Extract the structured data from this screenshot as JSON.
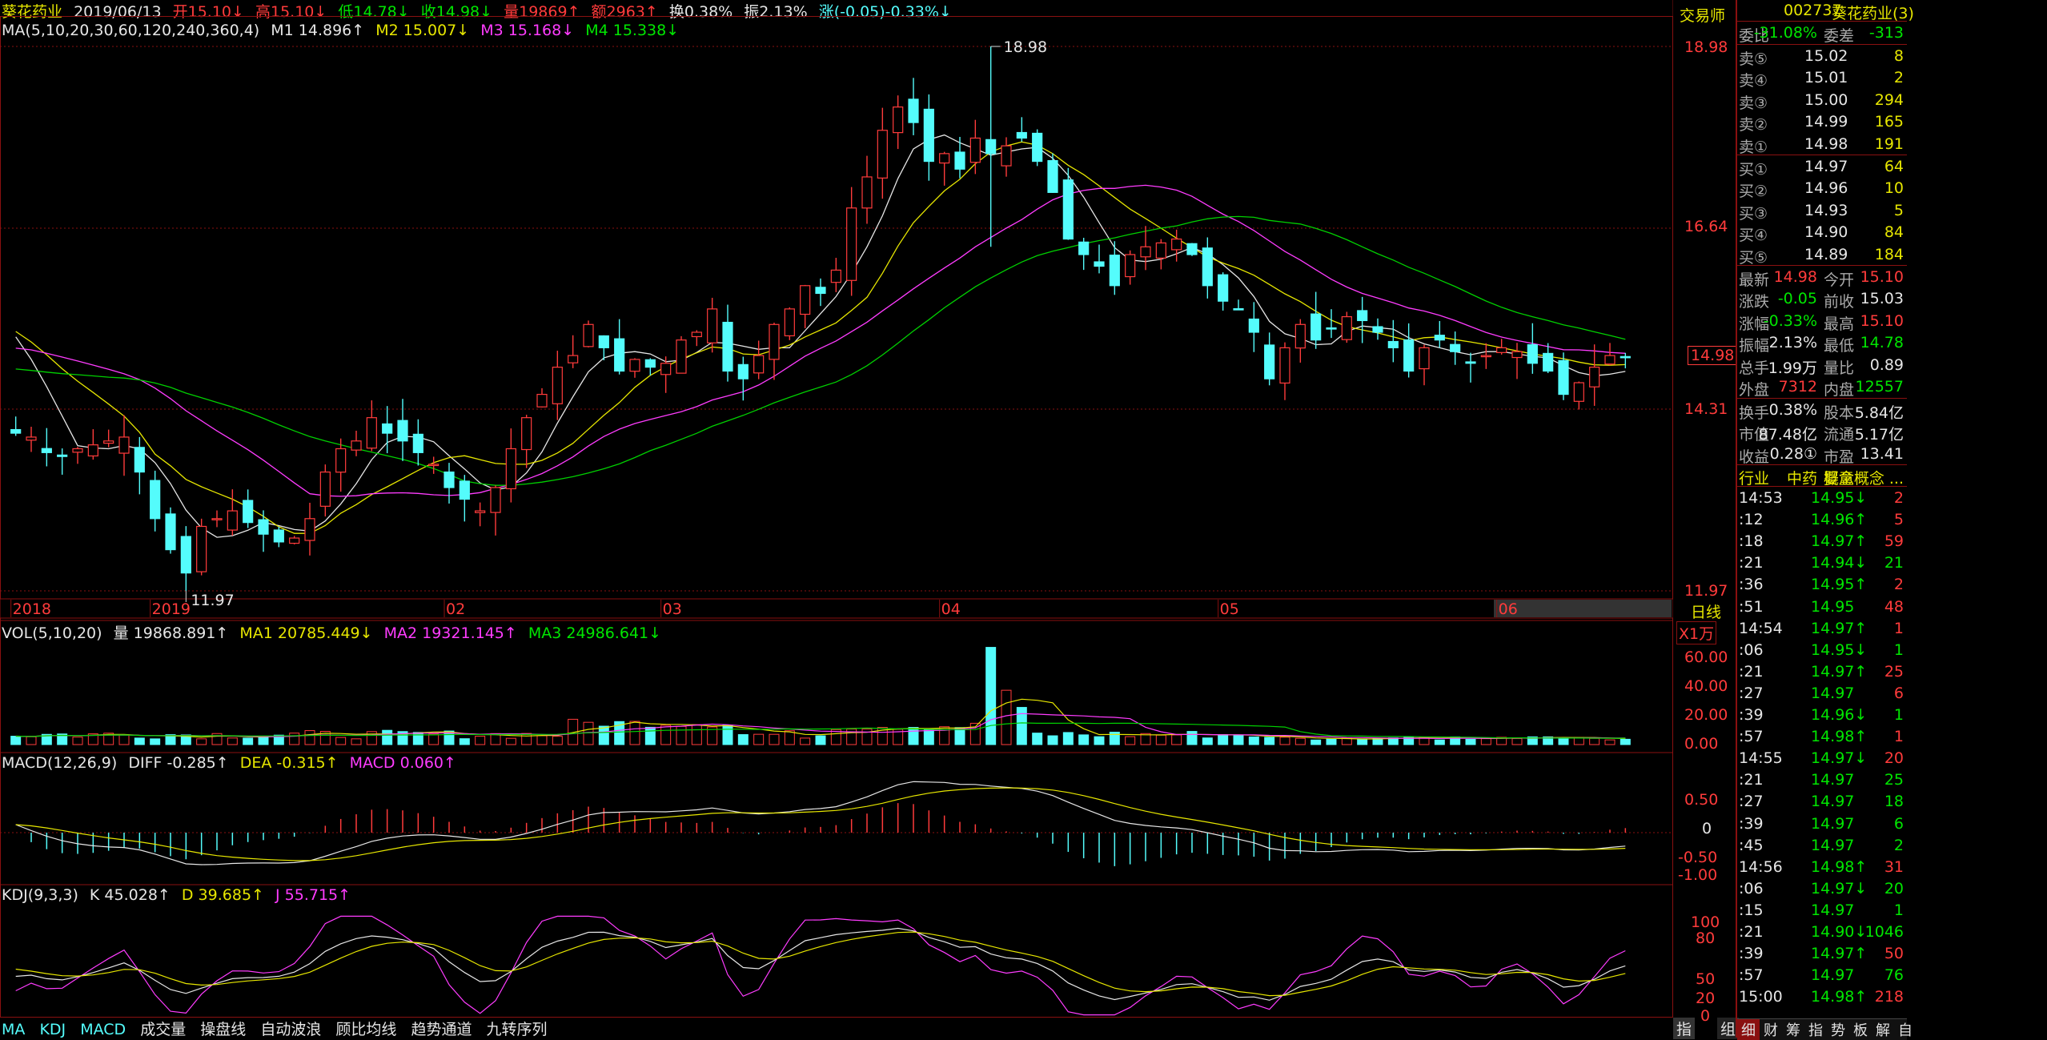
{
  "header": {
    "name": "葵花药业",
    "date": "2019/06/13",
    "open": "开15.10↓",
    "high": "高15.10↓",
    "low": "低14.78↓",
    "close": "收14.98↓",
    "vol": "量19869↑",
    "amount": "额2963↑",
    "turnover": "换0.38%",
    "amplitude": "振2.13%",
    "change": "涨(-0.05)-0.33%↓"
  },
  "ma_line": {
    "label": "MA(5,10,20,30,60,120,240,360,4)",
    "m1": "M1 14.896↑",
    "m2": "M2 15.007↓",
    "m3": "M3 15.168↓",
    "m4": "M4 15.338↓"
  },
  "price_axis": [
    "18.98",
    "16.64",
    "14.31",
    "11.97"
  ],
  "current_price_tag": "14.98",
  "annotations": {
    "high": "18.98",
    "low": "11.97"
  },
  "month_labels": [
    {
      "t": "2018",
      "i": 0
    },
    {
      "t": "2019",
      "i": 9
    },
    {
      "t": "02",
      "i": 28
    },
    {
      "t": "03",
      "i": 42
    },
    {
      "t": "04",
      "i": 60
    },
    {
      "t": "05",
      "i": 78
    },
    {
      "t": "06",
      "i": 96
    }
  ],
  "period_label": "日线",
  "vol_panel": {
    "label": "VOL(5,10,20)",
    "v": "量 19868.891↑",
    "ma1": "MA1 20785.449↓",
    "ma2": "MA2 19321.145↑",
    "ma3": "MA3 24986.641↓",
    "unit": "X1万",
    "axis": [
      "60.00",
      "40.00",
      "20.00",
      "0.00"
    ]
  },
  "macd_panel": {
    "label": "MACD(12,26,9)",
    "diff": "DIFF -0.285↑",
    "dea": "DEA -0.315↑",
    "macd": "MACD 0.060↑",
    "axis": [
      "0.50",
      "0",
      "-0.50",
      "-1.00"
    ]
  },
  "kdj_panel": {
    "label": "KDJ(9,3,3)",
    "k": "K 45.028↑",
    "d": "D 39.685↑",
    "j": "J 55.715↑",
    "axis": [
      "100",
      "80",
      "50",
      "20",
      "0"
    ]
  },
  "bottom_toolbar": [
    "MA",
    "KDJ",
    "MACD",
    "成交量",
    "操盘线",
    "自动波浪",
    "顾比均线",
    "趋势通道",
    "九转序列"
  ],
  "bottom_right_tabs": [
    "指",
    "组"
  ],
  "trader_label": "交易师",
  "right_panel": {
    "code": "002737",
    "name": "葵花药业(3)",
    "weibi": {
      "l1": "委比",
      "v1": "-31.08%",
      "l2": "委差",
      "v2": "-313"
    },
    "asks": [
      {
        "l": "卖⑤",
        "p": "15.02",
        "q": "8"
      },
      {
        "l": "卖④",
        "p": "15.01",
        "q": "2"
      },
      {
        "l": "卖③",
        "p": "15.00",
        "q": "294"
      },
      {
        "l": "卖②",
        "p": "14.99",
        "q": "165"
      },
      {
        "l": "卖①",
        "p": "14.98",
        "q": "191"
      }
    ],
    "bids": [
      {
        "l": "买①",
        "p": "14.97",
        "q": "64"
      },
      {
        "l": "买②",
        "p": "14.96",
        "q": "10"
      },
      {
        "l": "买③",
        "p": "14.93",
        "q": "5"
      },
      {
        "l": "买④",
        "p": "14.90",
        "q": "84"
      },
      {
        "l": "买⑤",
        "p": "14.89",
        "q": "184"
      }
    ],
    "stats": [
      {
        "l1": "最新",
        "v1": "14.98",
        "c1": "red",
        "l2": "今开",
        "v2": "15.10",
        "c2": "red"
      },
      {
        "l1": "涨跌",
        "v1": "-0.05",
        "c1": "green",
        "l2": "前收",
        "v2": "15.03",
        "c2": "white"
      },
      {
        "l1": "涨幅",
        "v1": "-0.33%",
        "c1": "green",
        "l2": "最高",
        "v2": "15.10",
        "c2": "red"
      },
      {
        "l1": "振幅",
        "v1": "2.13%",
        "c1": "white",
        "l2": "最低",
        "v2": "14.78",
        "c2": "green"
      },
      {
        "l1": "总手",
        "v1": "1.99万",
        "c1": "white",
        "l2": "量比",
        "v2": "0.89",
        "c2": "white"
      },
      {
        "l1": "外盘",
        "v1": "7312",
        "c1": "red",
        "l2": "内盘",
        "v2": "12557",
        "c2": "green"
      }
    ],
    "stats2": [
      {
        "l1": "换手",
        "v1": "0.38%",
        "l2": "股本",
        "v2": "5.84亿"
      },
      {
        "l1": "市值",
        "v1": "87.48亿",
        "l2": "流通",
        "v2": "5.17亿"
      },
      {
        "l1": "收益",
        "v1": "0.28①",
        "l2": "市盈",
        "v2": "13.41"
      }
    ],
    "industry": {
      "l": "行业",
      "v": "中药",
      "l2": "概念",
      "v2": "婴童概念 ..."
    },
    "ticks": [
      {
        "t": "14:53",
        "p": "14.95↓",
        "pc": "green",
        "q": "2",
        "qc": "red"
      },
      {
        "t": ":12",
        "p": "14.96↑",
        "pc": "green",
        "q": "5",
        "qc": "red"
      },
      {
        "t": ":18",
        "p": "14.97↑",
        "pc": "green",
        "q": "59",
        "qc": "red"
      },
      {
        "t": ":21",
        "p": "14.94↓",
        "pc": "green",
        "q": "21",
        "qc": "green"
      },
      {
        "t": ":36",
        "p": "14.95↑",
        "pc": "green",
        "q": "2",
        "qc": "red"
      },
      {
        "t": ":51",
        "p": "14.95",
        "pc": "green",
        "q": "48",
        "qc": "red"
      },
      {
        "t": "14:54",
        "p": "14.97↑",
        "pc": "green",
        "q": "1",
        "qc": "red"
      },
      {
        "t": ":06",
        "p": "14.95↓",
        "pc": "green",
        "q": "1",
        "qc": "green"
      },
      {
        "t": ":21",
        "p": "14.97↑",
        "pc": "green",
        "q": "25",
        "qc": "red"
      },
      {
        "t": ":27",
        "p": "14.97",
        "pc": "green",
        "q": "6",
        "qc": "red"
      },
      {
        "t": ":39",
        "p": "14.96↓",
        "pc": "green",
        "q": "1",
        "qc": "green"
      },
      {
        "t": ":57",
        "p": "14.98↑",
        "pc": "green",
        "q": "1",
        "qc": "red"
      },
      {
        "t": "14:55",
        "p": "14.97↓",
        "pc": "green",
        "q": "20",
        "qc": "red"
      },
      {
        "t": ":21",
        "p": "14.97",
        "pc": "green",
        "q": "25",
        "qc": "green"
      },
      {
        "t": ":27",
        "p": "14.97",
        "pc": "green",
        "q": "18",
        "qc": "green"
      },
      {
        "t": ":39",
        "p": "14.97",
        "pc": "green",
        "q": "6",
        "qc": "green"
      },
      {
        "t": ":45",
        "p": "14.97",
        "pc": "green",
        "q": "2",
        "qc": "green"
      },
      {
        "t": "14:56",
        "p": "14.98↑",
        "pc": "green",
        "q": "31",
        "qc": "red"
      },
      {
        "t": ":06",
        "p": "14.97↓",
        "pc": "green",
        "q": "20",
        "qc": "green"
      },
      {
        "t": ":15",
        "p": "14.97",
        "pc": "green",
        "q": "1",
        "qc": "green"
      },
      {
        "t": ":21",
        "p": "14.90↓",
        "pc": "green",
        "q": "1046",
        "qc": "green"
      },
      {
        "t": ":39",
        "p": "14.97↑",
        "pc": "green",
        "q": "50",
        "qc": "red"
      },
      {
        "t": ":57",
        "p": "14.97",
        "pc": "green",
        "q": "76",
        "qc": "green"
      },
      {
        "t": "15:00",
        "p": "14.98↑",
        "pc": "green",
        "q": "218",
        "qc": "red"
      }
    ],
    "tabs": [
      "细",
      "财",
      "筹",
      "指",
      "势",
      "板",
      "解",
      "自"
    ]
  },
  "chart_data": {
    "type": "candlestick",
    "y_range": [
      11.97,
      18.98
    ],
    "highest": 18.98,
    "lowest": 11.97,
    "closes": [
      14.0,
      13.95,
      13.75,
      13.7,
      13.8,
      13.85,
      13.9,
      13.95,
      13.5,
      12.9,
      12.5,
      12.2,
      12.8,
      12.9,
      13.0,
      12.85,
      12.7,
      12.6,
      12.65,
      12.9,
      13.5,
      13.8,
      13.9,
      14.2,
      14.0,
      13.9,
      13.75,
      13.6,
      13.3,
      13.15,
      13.0,
      13.3,
      13.8,
      14.2,
      14.5,
      14.85,
      15.0,
      15.4,
      15.1,
      14.8,
      14.95,
      14.85,
      14.9,
      15.2,
      15.3,
      15.6,
      14.8,
      14.7,
      15.0,
      15.4,
      15.6,
      15.9,
      15.8,
      16.1,
      16.9,
      17.3,
      17.9,
      18.2,
      18.0,
      17.5,
      17.6,
      17.4,
      17.8,
      17.6,
      17.7,
      17.8,
      17.5,
      17.1,
      16.5,
      16.3,
      16.15,
      15.9,
      16.3,
      16.4,
      16.45,
      16.5,
      16.3,
      15.9,
      15.7,
      15.6,
      15.3,
      14.7,
      15.1,
      15.4,
      15.2,
      15.35,
      15.5,
      15.45,
      15.3,
      15.1,
      14.8,
      15.1,
      15.2,
      15.05,
      14.9,
      15.0,
      15.1,
      15.05,
      14.9,
      14.8,
      14.5,
      14.65,
      14.85,
      15.0,
      14.98
    ],
    "series": [
      {
        "name": "M1",
        "values_note": "5-day MA"
      },
      {
        "name": "M2"
      },
      {
        "name": "M3"
      },
      {
        "name": "M4"
      }
    ]
  }
}
